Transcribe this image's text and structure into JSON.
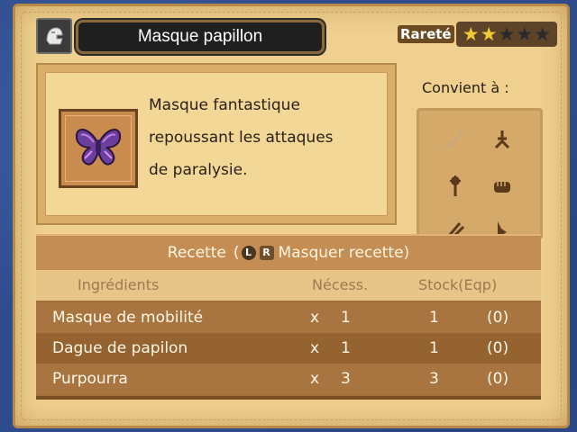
{
  "item": {
    "name": "Masque papillon",
    "description_lines": [
      "Masque fantastique",
      "repoussant les attaques",
      "de paralysie."
    ]
  },
  "rarity": {
    "label": "Rareté",
    "stars_filled": 2,
    "stars_total": 5
  },
  "suits": {
    "label": "Convient à :",
    "icons": [
      "sword-icon",
      "crossed-blades-icon",
      "staff-icon",
      "fist-icon",
      "claw-icon",
      "boomerang-icon"
    ]
  },
  "recipe": {
    "title": "Recette",
    "open_paren": "(",
    "button_l": "L",
    "button_r": "R",
    "toggle_text": "Masquer recette)"
  },
  "table": {
    "headers": {
      "ingredients": "Ingrédients",
      "needed": "Nécess.",
      "stock": "Stock(Eqp)"
    },
    "rows": [
      {
        "name": "Masque de mobilité",
        "times": "x",
        "qty": "1",
        "stock": "1",
        "eqp": "(0)"
      },
      {
        "name": "Dague de papilon",
        "times": "x",
        "qty": "1",
        "stock": "1",
        "eqp": "(0)"
      },
      {
        "name": "Purpourra",
        "times": "x",
        "qty": "3",
        "stock": "3",
        "eqp": "(0)"
      }
    ]
  },
  "colors": {
    "star_on": "#f0c83a",
    "star_off": "#2a2a2a",
    "parchment": "#efd08f",
    "row_dark": "#94632f"
  }
}
